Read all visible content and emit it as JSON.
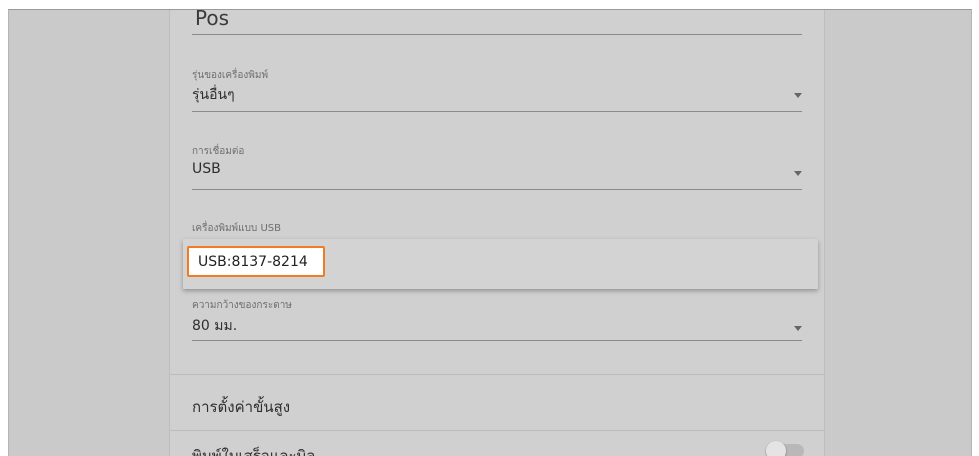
{
  "printer_name": {
    "value": "Pos"
  },
  "printer_model": {
    "label": "รุ่นของเครื่องพิมพ์",
    "value": "รุ่นอื่นๆ"
  },
  "connection": {
    "label": "การเชื่อมต่อ",
    "value": "USB"
  },
  "usb_printer": {
    "label": "เครื่องพิมพ์แบบ USB",
    "value": "USB:8137-8214",
    "highlight_color": "#f07b22"
  },
  "paper_width": {
    "label": "ความกว้างของกระดาษ",
    "value": "80 มม."
  },
  "advanced_settings": {
    "label": "การตั้งค่าขั้นสูง"
  },
  "bottom_option": {
    "label": "พิมพ์ใบเสร็จและบิล",
    "toggle_on": false
  },
  "icons": {
    "dropdown": "chevron-down-icon"
  }
}
